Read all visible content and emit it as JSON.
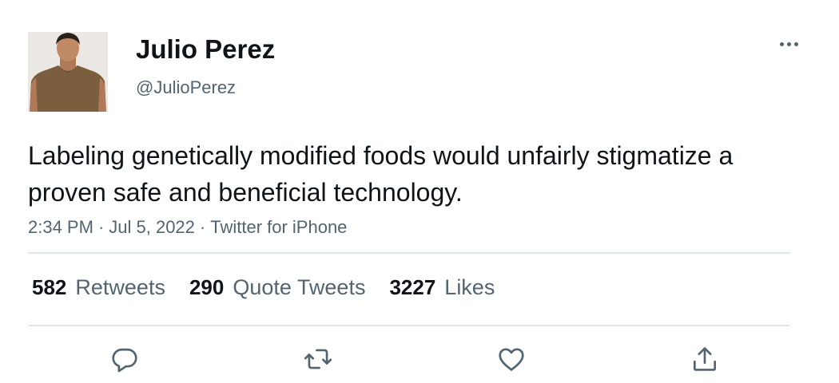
{
  "author": {
    "name": "Julio Perez",
    "handle": "@JulioPerez",
    "avatar_icon": "profile-photo"
  },
  "tweet": {
    "text": "Labeling genetically modified foods would unfairly stigmatize a proven safe and beneficial technology.",
    "time": "2:34 PM",
    "date": "Jul 5, 2022",
    "separator": "·",
    "source": "Twitter for iPhone"
  },
  "stats": {
    "retweets": {
      "count": "582",
      "label": "Retweets"
    },
    "quote_tweets": {
      "count": "290",
      "label": "Quote Tweets"
    },
    "likes": {
      "count": "3227",
      "label": "Likes"
    }
  },
  "actions": [
    "reply-icon",
    "retweet-icon",
    "like-icon",
    "share-icon"
  ],
  "colors": {
    "text_primary": "#0f1419",
    "text_secondary": "#536471",
    "divider": "#e1e5e8",
    "icon": "#536471"
  }
}
